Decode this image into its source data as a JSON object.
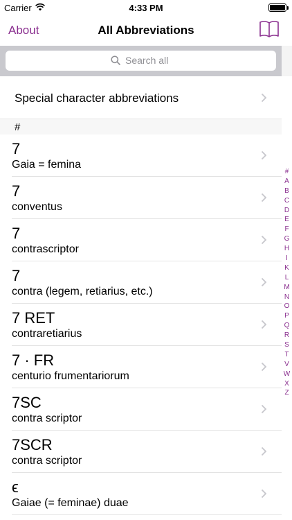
{
  "status": {
    "carrier": "Carrier",
    "time": "4:33 PM"
  },
  "nav": {
    "about": "About",
    "title": "All Abbreviations"
  },
  "search": {
    "placeholder": "Search all"
  },
  "special": {
    "label": "Special character abbreviations"
  },
  "section": {
    "label": "#"
  },
  "rows": [
    {
      "abbr": "7",
      "meaning": "Gaia = femina"
    },
    {
      "abbr": "7",
      "meaning": "conventus"
    },
    {
      "abbr": "7",
      "meaning": "contrascriptor"
    },
    {
      "abbr": "7",
      "meaning": "contra (legem, retiarius, etc.)"
    },
    {
      "abbr": "7 RET",
      "meaning": "contraretiarius"
    },
    {
      "abbr": "7 · FR",
      "meaning": "centurio frumentariorum"
    },
    {
      "abbr": "7SC",
      "meaning": "contra scriptor"
    },
    {
      "abbr": "7SCR",
      "meaning": "contra scriptor"
    },
    {
      "abbr": "ϵ",
      "meaning": "Gaiae (= feminae) duae"
    }
  ],
  "index": [
    "#",
    "A",
    "B",
    "C",
    "D",
    "E",
    "F",
    "G",
    "H",
    "I",
    "K",
    "L",
    "M",
    "N",
    "O",
    "P",
    "Q",
    "R",
    "S",
    "T",
    "V",
    "W",
    "X",
    "Z"
  ],
  "colors": {
    "accent": "#8a2f8f",
    "search_bar": "#c9c9ce"
  },
  "icons": {
    "wifi": "wifi-icon",
    "battery": "battery-icon",
    "book": "book-icon",
    "search": "search-icon",
    "chevron": "chevron-right-icon"
  }
}
